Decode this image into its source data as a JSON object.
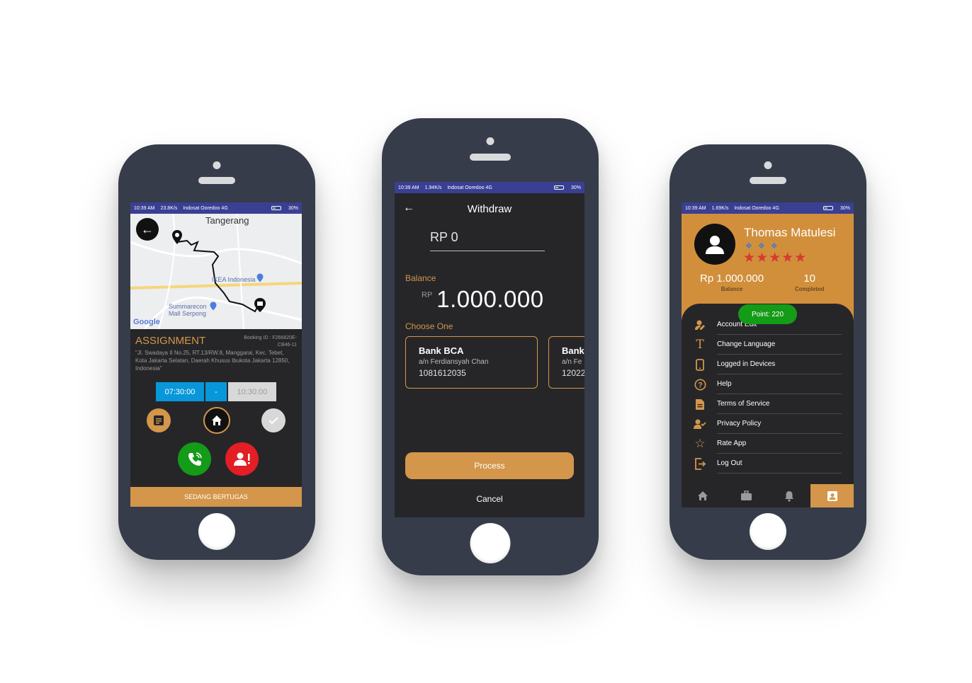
{
  "phone1": {
    "status": {
      "time": "10:39 AM",
      "speed": "23.8K/s",
      "carrier": "Indosat Ooredoo 4G",
      "battery": "30%"
    },
    "map": {
      "city": "Tangerang",
      "poi1": "IKEA Indonesia",
      "poi2_line1": "Summarecon",
      "poi2_line2": "Mall Serpong",
      "logo": "Google"
    },
    "assignment": {
      "title": "ASSIGNMENT",
      "booking": "Booking ID : F266820E-CB46-11",
      "address": "\"Jl. Swadaya II No.25, RT.13/RW.8, Manggarai, Kec. Tebet, Kota Jakarta Selatan, Daerah Khusus Ibukota Jakarta 12850, Indonesia\""
    },
    "times": {
      "start": "07:30:00",
      "separator": "-",
      "end": "10:30:00"
    },
    "footer": "SEDANG BERTUGAS",
    "colors": {
      "accent": "#d4964a",
      "call": "#149b17",
      "alert": "#e31e24",
      "time": "#0897d8"
    }
  },
  "phone2": {
    "status": {
      "time": "10:39 AM",
      "speed": "1.94K/s",
      "carrier": "Indosat Ooredoo 4G",
      "battery": "30%"
    },
    "header": {
      "title": "Withdraw"
    },
    "amount": "RP 0",
    "balance_label": "Balance",
    "balance_currency": "RP",
    "balance_value": "1.000.000",
    "choose_label": "Choose One",
    "banks": [
      {
        "name": "Bank BCA",
        "owner": "a/n Ferdiansyah Chan",
        "account": "1081612035"
      },
      {
        "name": "Bank",
        "owner": "a/n Fe",
        "account": "12022"
      }
    ],
    "process_label": "Process",
    "cancel_label": "Cancel"
  },
  "phone3": {
    "status": {
      "time": "10:39 AM",
      "speed": "1.69K/s",
      "carrier": "Indosat Ooredoo 4G",
      "battery": "30%"
    },
    "profile": {
      "name": "Thomas Matulesi",
      "rating": 5,
      "balance": "Rp 1.000.000",
      "balance_label": "Balance",
      "completed": "10",
      "completed_label": "Completed",
      "point": "Point:   220"
    },
    "menu": [
      {
        "label": "Account Edit",
        "icon": "account-edit-icon"
      },
      {
        "label": "Change Language",
        "icon": "text-icon"
      },
      {
        "label": "Logged in Devices",
        "icon": "phone-icon"
      },
      {
        "label": "Help",
        "icon": "help-icon"
      },
      {
        "label": "Terms of Service",
        "icon": "document-icon"
      },
      {
        "label": "Privacy Policy",
        "icon": "privacy-icon"
      },
      {
        "label": "Rate App",
        "icon": "star-icon"
      },
      {
        "label": "Log Out",
        "icon": "logout-icon"
      }
    ],
    "nav": [
      "home-icon",
      "briefcase-icon",
      "bell-icon",
      "profile-icon"
    ]
  }
}
